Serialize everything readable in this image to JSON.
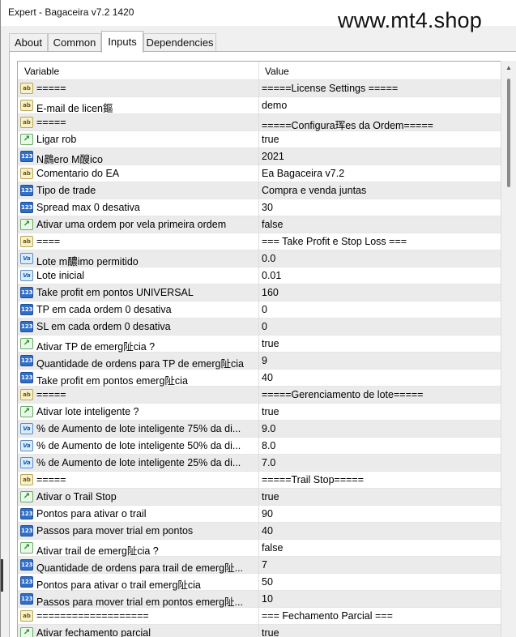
{
  "window": {
    "title": "Expert - Bagaceira v7.2 1420",
    "watermark": "www.mt4.shop"
  },
  "tabs": [
    {
      "label": "About",
      "active": false
    },
    {
      "label": "Common",
      "active": false
    },
    {
      "label": "Inputs",
      "active": true
    },
    {
      "label": "Dependencies",
      "active": false
    }
  ],
  "table": {
    "columns": {
      "variable": "Variable",
      "value": "Value"
    },
    "rows": [
      {
        "type": "str",
        "icon": "ab",
        "variable": "=====",
        "value": "=====License Settings ====="
      },
      {
        "type": "str",
        "icon": "ab",
        "variable": "E-mail de licen鏂",
        "value": "demo"
      },
      {
        "type": "str",
        "icon": "ab",
        "variable": "=====",
        "value": "=====Configura珲es da Ordem====="
      },
      {
        "type": "bool",
        "icon": "↗",
        "variable": "Ligar rob",
        "value": "true"
      },
      {
        "type": "int",
        "icon": "123",
        "variable": "N鷐ero M醙ico",
        "value": "2021"
      },
      {
        "type": "str",
        "icon": "ab",
        "variable": "Comentario do EA",
        "value": "Ea Bagaceira v7.2"
      },
      {
        "type": "int",
        "icon": "123",
        "variable": "Tipo de trade",
        "value": "Compra e venda juntas"
      },
      {
        "type": "int",
        "icon": "123",
        "variable": "Spread max 0 desativa",
        "value": "30"
      },
      {
        "type": "bool",
        "icon": "↗",
        "variable": "Ativar uma ordem por vela primeira ordem",
        "value": "false"
      },
      {
        "type": "str",
        "icon": "ab",
        "variable": "====",
        "value": "=== Take Profit e Stop Loss ==="
      },
      {
        "type": "dbl",
        "icon": "Va",
        "variable": "Lote m醲imo permitido",
        "value": "0.0"
      },
      {
        "type": "dbl",
        "icon": "Va",
        "variable": "Lote inicial",
        "value": "0.01"
      },
      {
        "type": "int",
        "icon": "123",
        "variable": "Take profit em pontos UNIVERSAL",
        "value": "160"
      },
      {
        "type": "int",
        "icon": "123",
        "variable": "TP em cada ordem 0 desativa",
        "value": "0"
      },
      {
        "type": "int",
        "icon": "123",
        "variable": "SL em cada ordem 0 desativa",
        "value": "0"
      },
      {
        "type": "bool",
        "icon": "↗",
        "variable": "Ativar TP de emerg阯cia ?",
        "value": "true"
      },
      {
        "type": "int",
        "icon": "123",
        "variable": "Quantidade de ordens para TP de emerg阯cia",
        "value": "9"
      },
      {
        "type": "int",
        "icon": "123",
        "variable": "Take profit em pontos emerg阯cia",
        "value": "40"
      },
      {
        "type": "str",
        "icon": "ab",
        "variable": "=====",
        "value": "=====Gerenciamento de lote====="
      },
      {
        "type": "bool",
        "icon": "↗",
        "variable": "Ativar lote inteligente ?",
        "value": "true"
      },
      {
        "type": "dbl",
        "icon": "Va",
        "variable": "% de Aumento de lote inteligente 75% da di...",
        "value": "9.0"
      },
      {
        "type": "dbl",
        "icon": "Va",
        "variable": "% de Aumento de lote inteligente 50% da di...",
        "value": "8.0"
      },
      {
        "type": "dbl",
        "icon": "Va",
        "variable": "% de Aumento de lote inteligente 25% da di...",
        "value": "7.0"
      },
      {
        "type": "str",
        "icon": "ab",
        "variable": "=====",
        "value": "=====Trail Stop====="
      },
      {
        "type": "bool",
        "icon": "↗",
        "variable": "Ativar o Trail Stop",
        "value": "true"
      },
      {
        "type": "int",
        "icon": "123",
        "variable": "Pontos para ativar o trail",
        "value": "90"
      },
      {
        "type": "int",
        "icon": "123",
        "variable": "Passos para mover trial em pontos",
        "value": "40"
      },
      {
        "type": "bool",
        "icon": "↗",
        "variable": "Ativar trail de emerg阯cia ?",
        "value": "false"
      },
      {
        "type": "int",
        "icon": "123",
        "variable": "Quantidade de ordens para trail de emerg阯...",
        "value": "7"
      },
      {
        "type": "int",
        "icon": "123",
        "variable": "Pontos para ativar o trail emerg阯cia",
        "value": "50"
      },
      {
        "type": "int",
        "icon": "123",
        "variable": "Passos para mover trial em pontos emerg阯...",
        "value": "10"
      },
      {
        "type": "str",
        "icon": "ab",
        "variable": "===================",
        "value": "===  Fechamento Parcial ==="
      },
      {
        "type": "bool",
        "icon": "↗",
        "variable": "Ativar fechamento parcial",
        "value": "true"
      }
    ]
  }
}
